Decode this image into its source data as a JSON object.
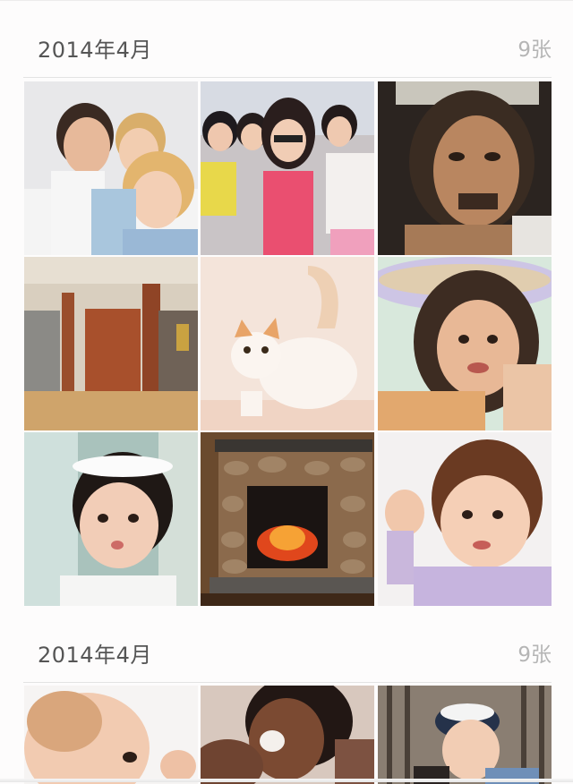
{
  "sections": [
    {
      "title": "2014年4月",
      "count": "9张",
      "photos": [
        {
          "icon": "family-portrait-photo"
        },
        {
          "icon": "friends-group-photo"
        },
        {
          "icon": "man-portrait-photo"
        },
        {
          "icon": "interior-hallway-photo"
        },
        {
          "icon": "kitten-photo"
        },
        {
          "icon": "girl-bubble-photo"
        },
        {
          "icon": "baby-flower-crown-photo"
        },
        {
          "icon": "stone-fireplace-photo"
        },
        {
          "icon": "toddler-waving-photo"
        }
      ]
    },
    {
      "title": "2014年4月",
      "count": "9张",
      "photos": [
        {
          "icon": "baby-profile-photo"
        },
        {
          "icon": "laughing-woman-photo"
        },
        {
          "icon": "child-captain-hat-photo"
        }
      ]
    }
  ]
}
